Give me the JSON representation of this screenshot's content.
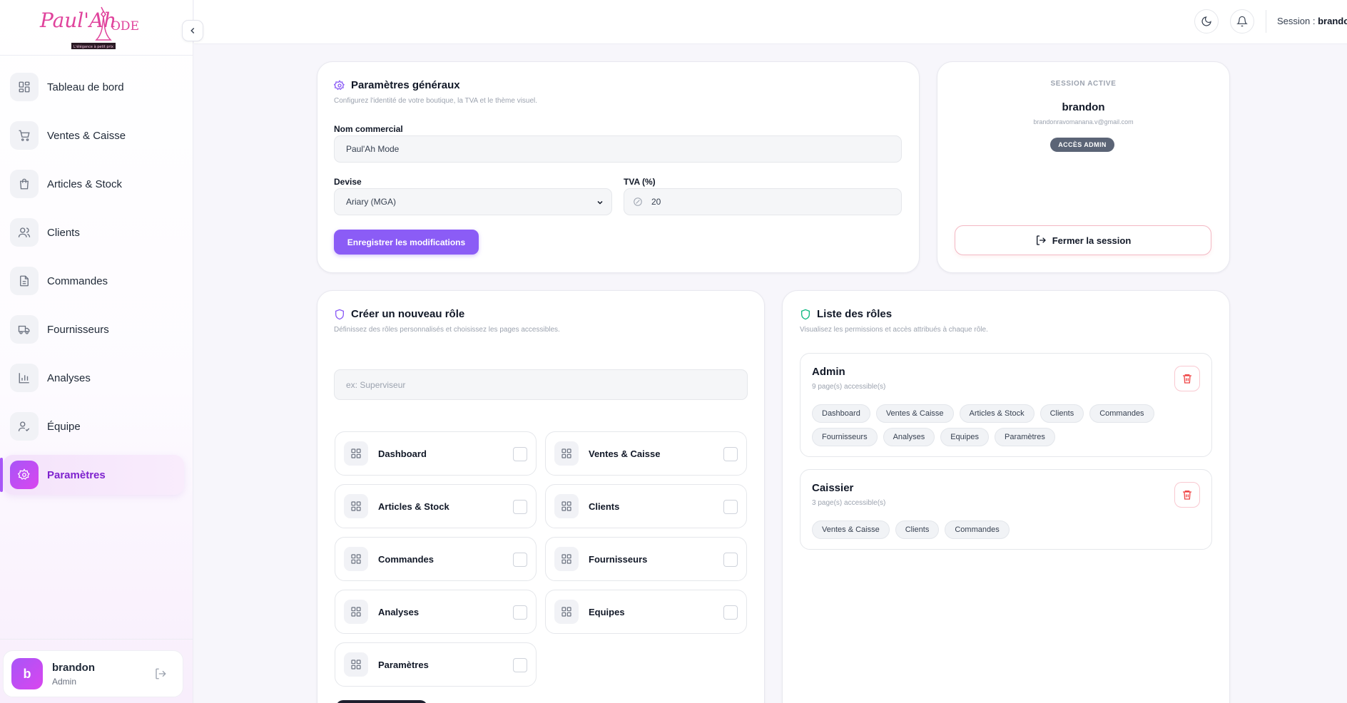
{
  "brand": {
    "logo_text": "Paul'Ah MODE",
    "tagline": "L'élégance à petit prix"
  },
  "sidebar": {
    "items": [
      {
        "label": "Tableau de bord",
        "icon": "layout-grid-icon"
      },
      {
        "label": "Ventes & Caisse",
        "icon": "cart-icon"
      },
      {
        "label": "Articles & Stock",
        "icon": "shopping-bag-icon"
      },
      {
        "label": "Clients",
        "icon": "users-icon"
      },
      {
        "label": "Commandes",
        "icon": "file-text-icon"
      },
      {
        "label": "Fournisseurs",
        "icon": "truck-icon"
      },
      {
        "label": "Analyses",
        "icon": "bar-chart-icon"
      },
      {
        "label": "Équipe",
        "icon": "user-check-icon"
      },
      {
        "label": "Paramètres",
        "icon": "gear-icon",
        "active": true
      }
    ],
    "user": {
      "initial": "b",
      "name": "brandon",
      "role": "Admin"
    }
  },
  "topbar": {
    "session_prefix": "Session :",
    "session_user": "brandon"
  },
  "general": {
    "title": "Paramètres généraux",
    "subtitle": "Configurez l'identité de votre boutique, la TVA et le thème visuel.",
    "name_label": "Nom commercial",
    "name_value": "Paul'Ah Mode",
    "currency_label": "Devise",
    "currency_value": "Ariary (MGA)",
    "tva_label": "TVA (%)",
    "tva_value": "20",
    "save_label": "Enregistrer les modifications"
  },
  "session_card": {
    "heading": "SESSION ACTIVE",
    "name": "brandon",
    "email": "brandonravomanana.v@gmail.com",
    "badge": "ACCÈS ADMIN",
    "close_label": "Fermer la session"
  },
  "new_role": {
    "title": "Créer un nouveau rôle",
    "subtitle": "Définissez des rôles personnalisés et choisissez les pages accessibles.",
    "placeholder": "ex: Superviseur",
    "pages": [
      "Dashboard",
      "Ventes & Caisse",
      "Articles & Stock",
      "Clients",
      "Commandes",
      "Fournisseurs",
      "Analyses",
      "Equipes",
      "Paramètres"
    ]
  },
  "roles_list": {
    "title": "Liste des rôles",
    "subtitle": "Visualisez les permissions et accès attribués à chaque rôle.",
    "roles": [
      {
        "name": "Admin",
        "count": "9 page(s) accessible(s)",
        "pages": [
          "Dashboard",
          "Ventes & Caisse",
          "Articles & Stock",
          "Clients",
          "Commandes",
          "Fournisseurs",
          "Analyses",
          "Equipes",
          "Paramètres"
        ]
      },
      {
        "name": "Caissier",
        "count": "3 page(s) accessible(s)",
        "pages": [
          "Ventes & Caisse",
          "Clients",
          "Commandes"
        ]
      }
    ]
  },
  "colors": {
    "accent": "#8b5cf6",
    "brand_pink": "#d946ef",
    "danger": "#ef4444",
    "badge": "#5b6476"
  }
}
